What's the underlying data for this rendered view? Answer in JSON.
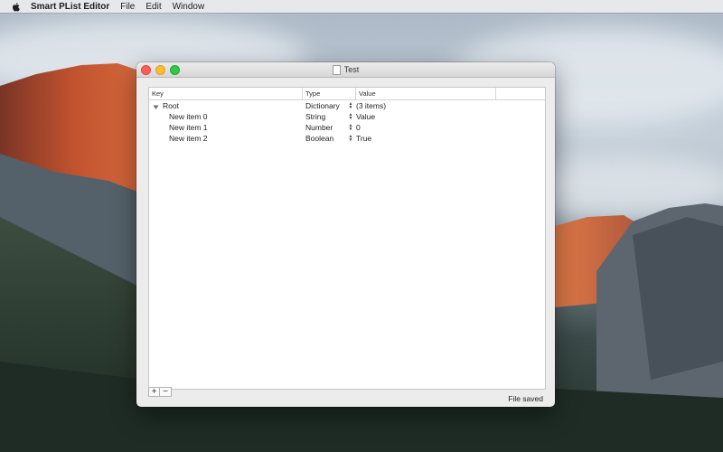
{
  "menubar": {
    "apple_icon": "apple-logo-icon",
    "app_name": "Smart PList Editor",
    "menus": [
      "File",
      "Edit",
      "Window"
    ]
  },
  "window": {
    "title": "Test",
    "title_icon": "document-icon",
    "controls": [
      "close",
      "minimize",
      "zoom"
    ],
    "colors": {
      "close": "#fc5f57",
      "minimize": "#fdbd2e",
      "zoom": "#33c748"
    }
  },
  "table": {
    "headers": {
      "key": "Key",
      "type": "Type",
      "value": "Value"
    },
    "rows": [
      {
        "key": "Root",
        "type": "Dictionary",
        "value": "(3 items)",
        "expanded": true
      },
      {
        "key": "New item 0",
        "type": "String",
        "value": "Value"
      },
      {
        "key": "New item 1",
        "type": "Number",
        "value": "0"
      },
      {
        "key": "New item 2",
        "type": "Boolean",
        "value": "True"
      }
    ]
  },
  "footer": {
    "add_label": "+",
    "remove_label": "−",
    "status": "File saved"
  }
}
